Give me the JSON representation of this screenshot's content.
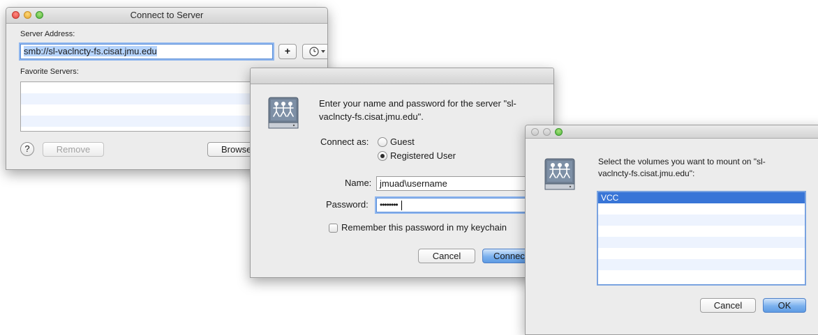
{
  "connect_window": {
    "title": "Connect to Server",
    "server_address_label": "Server Address:",
    "server_address_value": "smb://sl-vaclncty-fs.cisat.jmu.edu",
    "add_button": "+",
    "recent_icon": "clock-icon",
    "favorite_servers_label": "Favorite Servers:",
    "help_label": "?",
    "remove_button": "Remove",
    "browse_button": "Browse"
  },
  "auth_dialog": {
    "icon": "network-server-icon",
    "message_line1": "Enter your name and password for the server \"sl-",
    "message_line2": "vaclncty-fs.cisat.jmu.edu\".",
    "connect_as_label": "Connect as:",
    "guest_option": "Guest",
    "registered_option": "Registered User",
    "selected_option": "Registered User",
    "name_label": "Name:",
    "name_value": "jmuad\\username",
    "password_label": "Password:",
    "password_value": "••••••••",
    "remember_label": "Remember this password in my keychain",
    "cancel_button": "Cancel",
    "connect_button": "Connect"
  },
  "volumes_dialog": {
    "icon": "network-server-icon",
    "message_line1": "Select the volumes you want to mount on \"sl-",
    "message_line2": "vaclncty-fs.cisat.jmu.edu\":",
    "volumes": [
      "VCC"
    ],
    "selected_volume": "VCC",
    "cancel_button": "Cancel",
    "ok_button": "OK"
  }
}
